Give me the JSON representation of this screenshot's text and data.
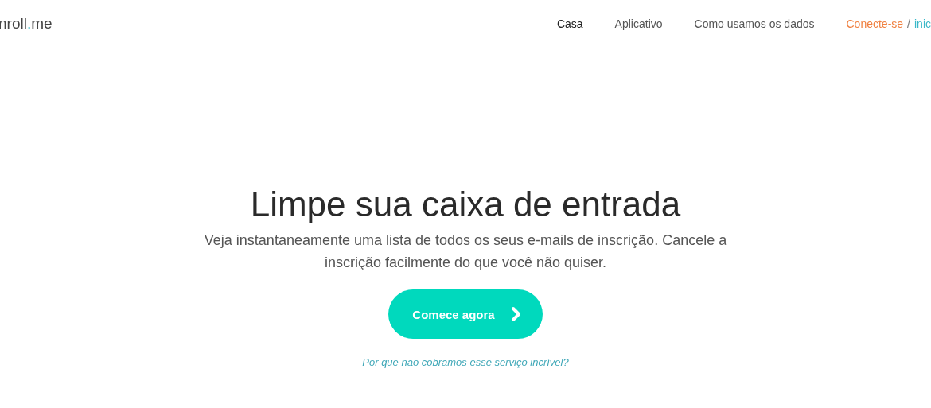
{
  "logo": {
    "parts": [
      "nroll",
      ".",
      "me"
    ]
  },
  "nav": [
    {
      "label": "Casa",
      "selected": true
    },
    {
      "label": "Aplicativo",
      "selected": false
    },
    {
      "label": "Como usamos os dados",
      "selected": false
    }
  ],
  "auth": {
    "login": "Conecte-se",
    "separator": "/",
    "signup": "inic"
  },
  "hero": {
    "title": "Limpe sua caixa de entrada",
    "subtitle": "Veja instantaneamente uma lista de todos os seus e-mails de inscrição. Cancele a inscrição facilmente do que você não quiser.",
    "button": "Comece agora",
    "link": "Por que não cobramos esse serviço incrível?"
  }
}
